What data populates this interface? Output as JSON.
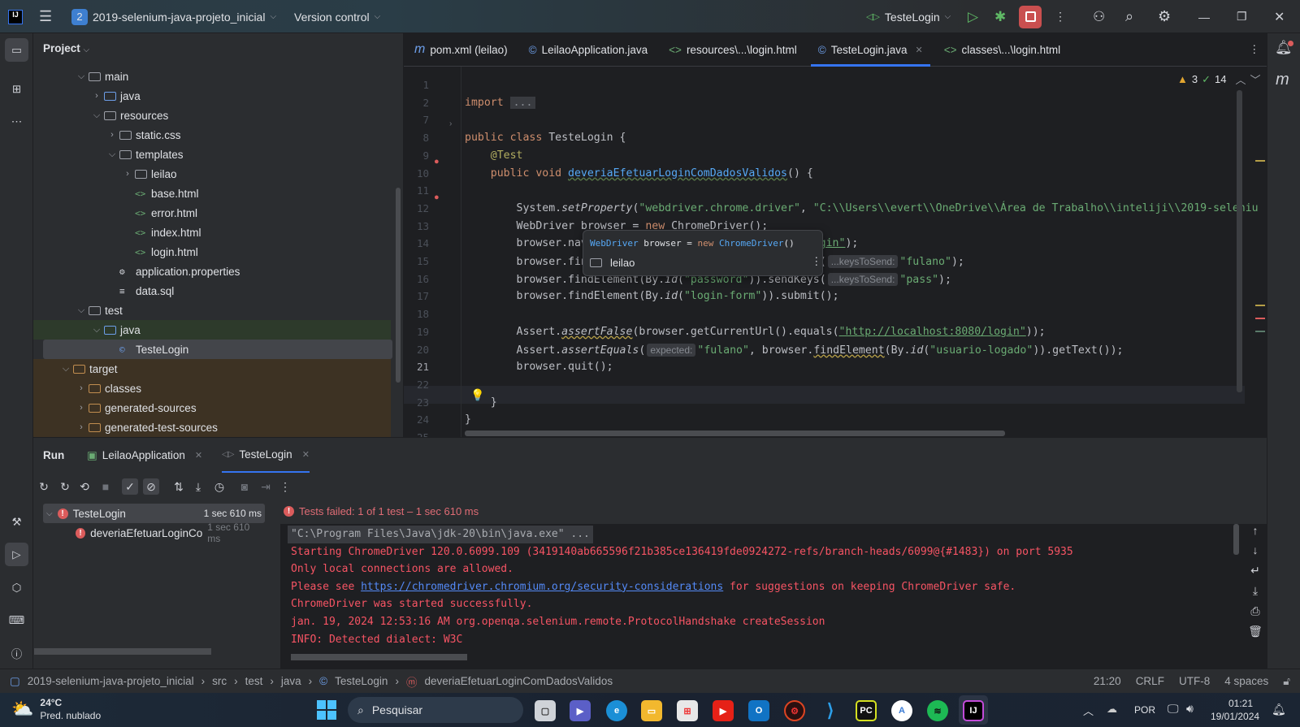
{
  "titlebar": {
    "project_badge": "2",
    "project_name": "2019-selenium-java-projeto_inicial",
    "vcs": "Version control",
    "run_config": "TesteLogin",
    "colors": {
      "stop": "#c94f4f",
      "run": "#5fb865"
    }
  },
  "project_panel": {
    "title": "Project",
    "tree": [
      {
        "label": "main",
        "level": 0,
        "type": "folder",
        "expanded": true
      },
      {
        "label": "java",
        "level": 1,
        "type": "folder-src",
        "expanded": false
      },
      {
        "label": "resources",
        "level": 1,
        "type": "folder",
        "expanded": true
      },
      {
        "label": "static.css",
        "level": 2,
        "type": "folder",
        "expanded": false
      },
      {
        "label": "templates",
        "level": 2,
        "type": "folder",
        "expanded": true
      },
      {
        "label": "leilao",
        "level": 3,
        "type": "folder",
        "expanded": false
      },
      {
        "label": "base.html",
        "level": 3,
        "type": "html"
      },
      {
        "label": "error.html",
        "level": 3,
        "type": "html"
      },
      {
        "label": "index.html",
        "level": 3,
        "type": "html"
      },
      {
        "label": "login.html",
        "level": 3,
        "type": "html"
      },
      {
        "label": "application.properties",
        "level": 2,
        "type": "props"
      },
      {
        "label": "data.sql",
        "level": 2,
        "type": "sql"
      },
      {
        "label": "test",
        "level": 0,
        "type": "folder",
        "expanded": true
      },
      {
        "label": "java",
        "level": 1,
        "type": "folder-test",
        "expanded": true,
        "highlight": "green"
      },
      {
        "label": "TesteLogin",
        "level": 2,
        "type": "class",
        "selected": true
      },
      {
        "label": "target",
        "level": -1,
        "type": "folder-excluded",
        "expanded": true,
        "highlight": "brown"
      },
      {
        "label": "classes",
        "level": 0,
        "type": "folder-excluded",
        "expanded": false,
        "highlight": "brown"
      },
      {
        "label": "generated-sources",
        "level": 0,
        "type": "folder-excluded",
        "expanded": false,
        "highlight": "brown"
      },
      {
        "label": "generated-test-sources",
        "level": 0,
        "type": "folder-excluded",
        "expanded": false,
        "highlight": "brown"
      }
    ]
  },
  "editor": {
    "tabs": [
      {
        "label": "pom.xml (leilao)",
        "icon": "maven-icon"
      },
      {
        "label": "LeilaoApplication.java",
        "icon": "class-icon"
      },
      {
        "label": "resources\\...\\login.html",
        "icon": "html-icon"
      },
      {
        "label": "TesteLogin.java",
        "icon": "class-icon",
        "active": true
      },
      {
        "label": "classes\\...\\login.html",
        "icon": "html-icon"
      }
    ],
    "warnings": "3",
    "checks": "14",
    "lines": [
      {
        "n": "1",
        "seg": []
      },
      {
        "n": "2",
        "seg": [
          [
            "kw",
            "import "
          ],
          [
            "fold-txt",
            "..."
          ]
        ]
      },
      {
        "n": "7",
        "seg": []
      },
      {
        "n": "8",
        "seg": [
          [
            "kw",
            "public class "
          ],
          [
            "",
            "TesteLogin {"
          ]
        ]
      },
      {
        "n": "9",
        "seg": [
          [
            "ann",
            "    @Test"
          ]
        ]
      },
      {
        "n": "10",
        "seg": [
          [
            "kw",
            "    public void "
          ],
          [
            "fn wavy",
            "deveriaEfetuarLoginComDadosValidos"
          ],
          [
            "",
            "() {"
          ]
        ]
      },
      {
        "n": "11",
        "seg": []
      },
      {
        "n": "12",
        "seg": [
          [
            "",
            "        System."
          ],
          [
            "it",
            "setProperty"
          ],
          [
            "",
            "("
          ],
          [
            "str",
            "\"webdriver.chrome.driver\""
          ],
          [
            "",
            ", "
          ],
          [
            "str",
            "\"C:\\\\Users\\\\evert\\\\OneDrive\\\\Área de Trabalho\\\\inteliji\\\\2019-seleniu"
          ]
        ]
      },
      {
        "n": "13",
        "seg": [
          [
            "",
            "        WebDriver browser = "
          ],
          [
            "kw",
            "new "
          ],
          [
            "",
            "ChromeDriver();"
          ]
        ]
      },
      {
        "n": "14",
        "seg": [
          [
            "",
            "        browser.navigate().to("
          ],
          [
            "str url",
            "\"http://localhost:8080/login\""
          ],
          [
            "",
            ");"
          ]
        ]
      },
      {
        "n": "15",
        "seg": [
          [
            "",
            "        browser.findElement(By."
          ],
          [
            "it",
            "id"
          ],
          [
            "",
            "("
          ],
          [
            "str",
            "\"username\""
          ],
          [
            "",
            "))."
          ],
          [
            "",
            "sendKeys("
          ],
          [
            "inlay",
            "...keysToSend:"
          ],
          [
            "str",
            "\"fulano\""
          ],
          [
            "",
            ");"
          ]
        ]
      },
      {
        "n": "16",
        "seg": [
          [
            "",
            "        browser.findElement(By."
          ],
          [
            "it",
            "id"
          ],
          [
            "",
            "("
          ],
          [
            "str",
            "\"password\""
          ],
          [
            "",
            "))."
          ],
          [
            "",
            "sendKeys("
          ],
          [
            "inlay",
            "...keysToSend:"
          ],
          [
            "str",
            "\"pass\""
          ],
          [
            "",
            ");"
          ]
        ]
      },
      {
        "n": "17",
        "seg": [
          [
            "",
            "        browser.findElement(By."
          ],
          [
            "it",
            "id"
          ],
          [
            "",
            "("
          ],
          [
            "str",
            "\"login-form\""
          ],
          [
            "",
            "))."
          ],
          [
            "",
            "submit();"
          ]
        ]
      },
      {
        "n": "18",
        "seg": []
      },
      {
        "n": "19",
        "seg": [
          [
            "",
            "        Assert."
          ],
          [
            "it wy",
            "assertFalse"
          ],
          [
            "",
            "(browser.getCurrentUrl().equals("
          ],
          [
            "str url",
            "\"http://localhost:8080/login\""
          ],
          [
            "",
            "));"
          ]
        ]
      },
      {
        "n": "20",
        "seg": [
          [
            "",
            "        Assert."
          ],
          [
            "it",
            "assertEquals"
          ],
          [
            "",
            "("
          ],
          [
            "inlay",
            "expected:"
          ],
          [
            "str",
            "\"fulano\""
          ],
          [
            "",
            ", browser."
          ],
          [
            "wy",
            "findElement"
          ],
          [
            "",
            "(By."
          ],
          [
            "it",
            "id"
          ],
          [
            "",
            "("
          ],
          [
            "str",
            "\"usuario-logado\""
          ],
          [
            "",
            ")).getText());"
          ]
        ]
      },
      {
        "n": "21",
        "seg": [
          [
            "",
            "        browser.quit();"
          ]
        ],
        "current": true
      },
      {
        "n": "22",
        "seg": []
      },
      {
        "n": "23",
        "seg": [
          [
            "",
            "    }"
          ]
        ]
      },
      {
        "n": "24",
        "seg": [
          [
            "",
            "}"
          ]
        ]
      },
      {
        "n": "25",
        "seg": []
      }
    ],
    "popup": {
      "kw1": "WebDriver",
      "mid": " browser = ",
      "kw2": "new ",
      "cls": "ChromeDriver",
      "end": "()",
      "module": "leilao"
    }
  },
  "run_panel": {
    "title": "Run",
    "tabs": [
      "LeilaoApplication",
      "TesteLogin"
    ],
    "tree": [
      {
        "label": "TesteLogin",
        "time": "1 sec 610 ms"
      },
      {
        "label": "deveriaEfetuarLoginCo",
        "time": "1 sec 610 ms"
      }
    ],
    "summary": "Tests failed: 1 of 1 test – 1 sec 610 ms",
    "console": [
      "\"C:\\Program Files\\Java\\jdk-20\\bin\\java.exe\" ...",
      "Starting ChromeDriver 120.0.6099.109 (3419140ab665596f21b385ce136419fde0924272-refs/branch-heads/6099@{#1483}) on port 5935",
      "Only local connections are allowed.",
      [
        "Please see ",
        "https://chromedriver.chromium.org/security-considerations",
        " for suggestions on keeping ChromeDriver safe."
      ],
      "ChromeDriver was started successfully.",
      "jan. 19, 2024 12:53:16 AM org.openqa.selenium.remote.ProtocolHandshake createSession",
      "INFO: Detected dialect: W3C"
    ]
  },
  "statusbar": {
    "breadcrumb": [
      "2019-selenium-java-projeto_inicial",
      "src",
      "test",
      "java",
      "TesteLogin",
      "deveriaEfetuarLoginComDadosValidos"
    ],
    "position": "21:20",
    "line_ending": "CRLF",
    "encoding": "UTF-8",
    "indent": "4 spaces"
  },
  "taskbar": {
    "temp": "24°C",
    "weather": "Pred. nublado",
    "search": "Pesquisar",
    "lang": "POR",
    "time": "01:21",
    "date": "19/01/2024"
  }
}
